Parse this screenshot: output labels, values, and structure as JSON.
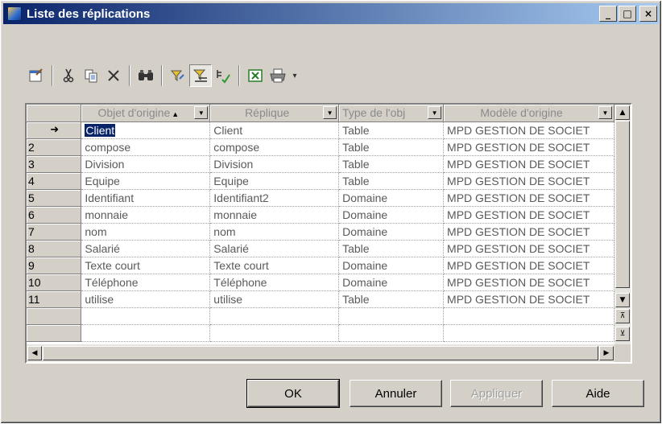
{
  "window": {
    "title": "Liste des réplications",
    "controls": {
      "minimize": "_",
      "maximize": "□",
      "close": "×"
    }
  },
  "toolbar": {
    "icons": [
      "properties-icon",
      "cut-icon",
      "copy-icon",
      "delete-icon",
      "find-icon",
      "filter-icon",
      "filter-active-icon",
      "customize-columns-icon",
      "excel-export-icon",
      "print-icon",
      "dropdown-arrow-icon"
    ]
  },
  "grid": {
    "columns": [
      {
        "label": "Objet d'origine",
        "sorted": "asc"
      },
      {
        "label": "Réplique"
      },
      {
        "label": "Type de l'obj"
      },
      {
        "label": "Modèle d'origine"
      }
    ],
    "current_row_marker": "➜",
    "rows": [
      {
        "num": "",
        "object": "Client",
        "replica": "Client",
        "type": "Table",
        "model": "MPD GESTION DE SOCIET"
      },
      {
        "num": "2",
        "object": "compose",
        "replica": "compose",
        "type": "Table",
        "model": "MPD GESTION DE SOCIET"
      },
      {
        "num": "3",
        "object": "Division",
        "replica": "Division",
        "type": "Table",
        "model": "MPD GESTION DE SOCIET"
      },
      {
        "num": "4",
        "object": "Equipe",
        "replica": "Equipe",
        "type": "Table",
        "model": "MPD GESTION DE SOCIET"
      },
      {
        "num": "5",
        "object": "Identifiant",
        "replica": "Identifiant2",
        "type": "Domaine",
        "model": "MPD GESTION DE SOCIET"
      },
      {
        "num": "6",
        "object": "monnaie",
        "replica": "monnaie",
        "type": "Domaine",
        "model": "MPD GESTION DE SOCIET"
      },
      {
        "num": "7",
        "object": "nom",
        "replica": "nom",
        "type": "Domaine",
        "model": "MPD GESTION DE SOCIET"
      },
      {
        "num": "8",
        "object": "Salarié",
        "replica": "Salarié",
        "type": "Table",
        "model": "MPD GESTION DE SOCIET"
      },
      {
        "num": "9",
        "object": "Texte court",
        "replica": "Texte court",
        "type": "Domaine",
        "model": "MPD GESTION DE SOCIET"
      },
      {
        "num": "10",
        "object": "Téléphone",
        "replica": "Téléphone",
        "type": "Domaine",
        "model": "MPD GESTION DE SOCIET"
      },
      {
        "num": "11",
        "object": "utilise",
        "replica": "utilise",
        "type": "Table",
        "model": "MPD GESTION DE SOCIET"
      }
    ]
  },
  "buttons": {
    "ok": "OK",
    "cancel": "Annuler",
    "apply": "Appliquer",
    "help": "Aide"
  }
}
